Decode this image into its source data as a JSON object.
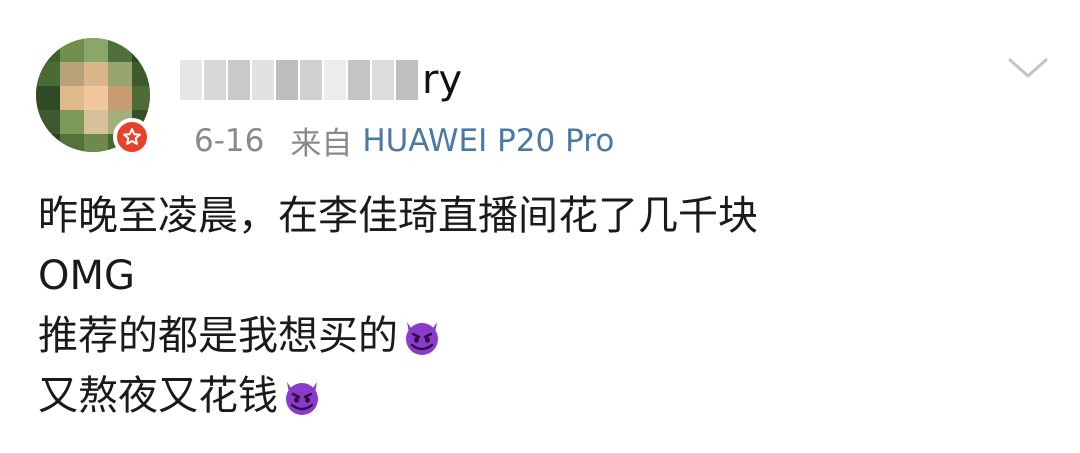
{
  "post": {
    "username_visible": "ry",
    "date": "6-16",
    "from_label": "来自",
    "device": "HUAWEI P20 Pro",
    "lines": [
      "昨晚至凌晨，在李佳琦直播间花了几千块",
      "OMG",
      "推荐的都是我想买的",
      "又熬夜又花钱"
    ],
    "line_emojis": [
      "",
      "",
      "smiling-devil-emoji",
      "smiling-devil-emoji"
    ]
  },
  "icons": {
    "verified": "verified-badge-icon",
    "menu": "chevron-down-icon"
  },
  "colors": {
    "meta_gray": "#8a8a8a",
    "device_link": "#4a7aa3",
    "badge_red": "#e8412b",
    "emoji_purple": "#8a3bc9"
  }
}
